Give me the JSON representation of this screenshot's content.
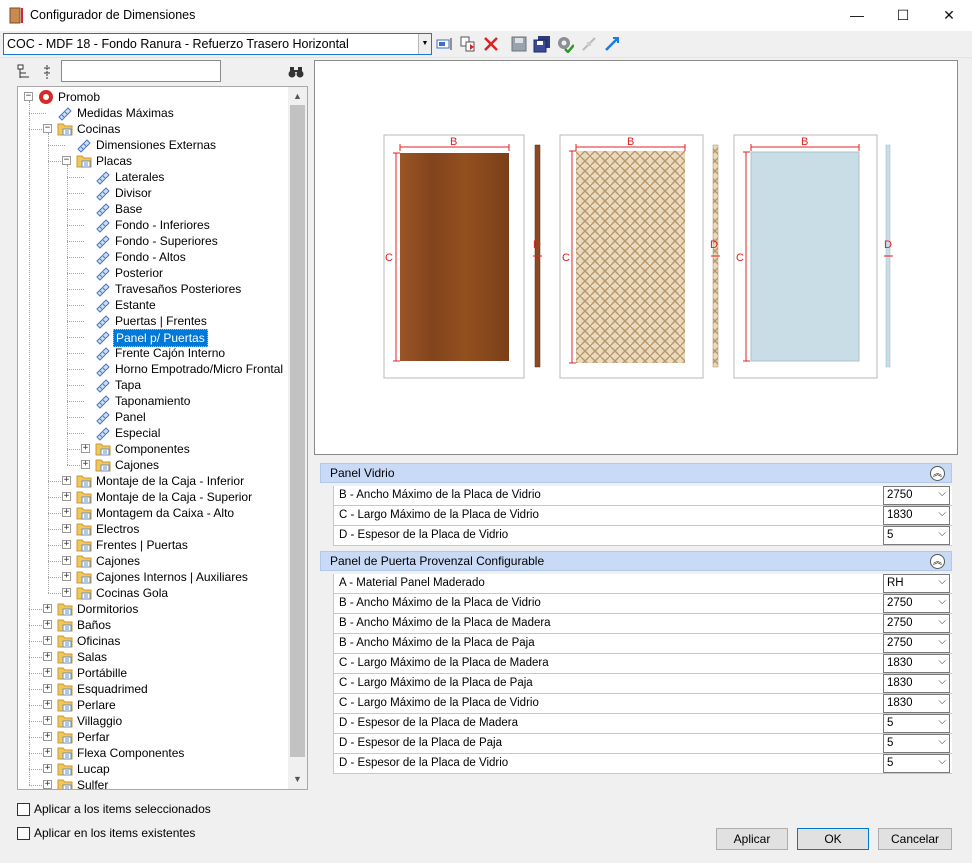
{
  "window": {
    "title": "Configurador de Dimensiones",
    "controls": {
      "minimize": "—",
      "maximize": "☐",
      "close": "✕"
    }
  },
  "toolbar": {
    "profile_value": "COC - MDF 18 - Fondo Ranura - Refuerzo Trasero Horizontal",
    "icons": [
      "rename-icon",
      "copy-icon",
      "delete-icon",
      "save-icon",
      "save-all-icon",
      "settings-gear-icon",
      "collapse-icon",
      "expand-icon"
    ]
  },
  "tree": {
    "search_placeholder": "",
    "items": [
      {
        "label": "Promob",
        "level": 0,
        "expander": "−",
        "icon": "promob"
      },
      {
        "label": "Medidas Máximas",
        "level": 1,
        "expander": "",
        "icon": "rule"
      },
      {
        "label": "Cocinas",
        "level": 1,
        "expander": "−",
        "icon": "folder"
      },
      {
        "label": "Dimensiones Externas",
        "level": 2,
        "expander": "",
        "icon": "rule"
      },
      {
        "label": "Placas",
        "level": 2,
        "expander": "−",
        "icon": "folder"
      },
      {
        "label": "Laterales",
        "level": 3,
        "expander": "",
        "icon": "rule"
      },
      {
        "label": "Divisor",
        "level": 3,
        "expander": "",
        "icon": "rule"
      },
      {
        "label": "Base",
        "level": 3,
        "expander": "",
        "icon": "rule"
      },
      {
        "label": "Fondo - Inferiores",
        "level": 3,
        "expander": "",
        "icon": "rule"
      },
      {
        "label": "Fondo - Superiores",
        "level": 3,
        "expander": "",
        "icon": "rule"
      },
      {
        "label": "Fondo - Altos",
        "level": 3,
        "expander": "",
        "icon": "rule"
      },
      {
        "label": "Posterior",
        "level": 3,
        "expander": "",
        "icon": "rule"
      },
      {
        "label": "Travesaños Posteriores",
        "level": 3,
        "expander": "",
        "icon": "rule"
      },
      {
        "label": "Estante",
        "level": 3,
        "expander": "",
        "icon": "rule"
      },
      {
        "label": "Puertas | Frentes",
        "level": 3,
        "expander": "",
        "icon": "rule"
      },
      {
        "label": "Panel p/ Puertas",
        "level": 3,
        "expander": "",
        "icon": "rule",
        "selected": true
      },
      {
        "label": "Frente Cajón Interno",
        "level": 3,
        "expander": "",
        "icon": "rule"
      },
      {
        "label": "Horno Empotrado/Micro Frontal",
        "level": 3,
        "expander": "",
        "icon": "rule"
      },
      {
        "label": "Tapa",
        "level": 3,
        "expander": "",
        "icon": "rule"
      },
      {
        "label": "Taponamiento",
        "level": 3,
        "expander": "",
        "icon": "rule"
      },
      {
        "label": "Panel",
        "level": 3,
        "expander": "",
        "icon": "rule"
      },
      {
        "label": "Especial",
        "level": 3,
        "expander": "",
        "icon": "rule"
      },
      {
        "label": "Componentes",
        "level": 3,
        "expander": "+",
        "icon": "folder"
      },
      {
        "label": "Cajones",
        "level": 3,
        "expander": "+",
        "icon": "folder"
      },
      {
        "label": "Montaje de la Caja - Inferior",
        "level": 2,
        "expander": "+",
        "icon": "folder"
      },
      {
        "label": "Montaje de la Caja - Superior",
        "level": 2,
        "expander": "+",
        "icon": "folder"
      },
      {
        "label": "Montagem da Caixa - Alto",
        "level": 2,
        "expander": "+",
        "icon": "folder"
      },
      {
        "label": "Electros",
        "level": 2,
        "expander": "+",
        "icon": "folder"
      },
      {
        "label": "Frentes | Puertas",
        "level": 2,
        "expander": "+",
        "icon": "folder"
      },
      {
        "label": "Cajones",
        "level": 2,
        "expander": "+",
        "icon": "folder"
      },
      {
        "label": "Cajones Internos | Auxiliares",
        "level": 2,
        "expander": "+",
        "icon": "folder"
      },
      {
        "label": "Cocinas Gola",
        "level": 2,
        "expander": "+",
        "icon": "folder"
      },
      {
        "label": "Dormitorios",
        "level": 1,
        "expander": "+",
        "icon": "folder"
      },
      {
        "label": "Baños",
        "level": 1,
        "expander": "+",
        "icon": "folder"
      },
      {
        "label": "Oficinas",
        "level": 1,
        "expander": "+",
        "icon": "folder"
      },
      {
        "label": "Salas",
        "level": 1,
        "expander": "+",
        "icon": "folder"
      },
      {
        "label": "Portábille",
        "level": 1,
        "expander": "+",
        "icon": "folder"
      },
      {
        "label": "Esquadrimed",
        "level": 1,
        "expander": "+",
        "icon": "folder"
      },
      {
        "label": "Perlare",
        "level": 1,
        "expander": "+",
        "icon": "folder"
      },
      {
        "label": "Villaggio",
        "level": 1,
        "expander": "+",
        "icon": "folder"
      },
      {
        "label": "Perfar",
        "level": 1,
        "expander": "+",
        "icon": "folder"
      },
      {
        "label": "Flexa Componentes",
        "level": 1,
        "expander": "+",
        "icon": "folder"
      },
      {
        "label": "Lucap",
        "level": 1,
        "expander": "+",
        "icon": "folder"
      },
      {
        "label": "Sulfer",
        "level": 1,
        "expander": "+",
        "icon": "folder"
      }
    ]
  },
  "options": {
    "apply_selected": "Aplicar a los items seleccionados",
    "apply_existing": "Aplicar en los items existentes"
  },
  "preview": {
    "dim_b": "B",
    "dim_c": "C",
    "dim_d": "D",
    "colors": {
      "wood": "#8b4a22",
      "straw": "#d9c09a",
      "glass": "#c9dde6",
      "dimension": "#e02020"
    }
  },
  "groups": [
    {
      "title": "Panel Vidrio",
      "rows": [
        {
          "label": "B -  Ancho Máximo de la Placa de Vidrio",
          "value": "2750"
        },
        {
          "label": "C - Largo Máximo de la Placa de Vidrio",
          "value": "1830"
        },
        {
          "label": "D - Espesor de la Placa de Vidrio",
          "value": "5"
        }
      ]
    },
    {
      "title": "Panel de Puerta Provenzal Configurable",
      "rows": [
        {
          "label": "A - Material Panel Maderado",
          "value": "RH"
        },
        {
          "label": "B -  Ancho Máximo de la Placa de Vidrio",
          "value": "2750"
        },
        {
          "label": "B - Ancho Máximo de la Placa de Madera",
          "value": "2750"
        },
        {
          "label": "B - Ancho Máximo de la Placa de Paja",
          "value": "2750"
        },
        {
          "label": "C - Largo Máximo de la Placa de Madera",
          "value": "1830"
        },
        {
          "label": "C - Largo Máximo de la Placa de Paja",
          "value": "1830"
        },
        {
          "label": "C - Largo Máximo de la Placa de Vidrio",
          "value": "1830"
        },
        {
          "label": "D - Espesor de la Placa de Madera",
          "value": "5"
        },
        {
          "label": "D - Espesor de la Placa de Paja",
          "value": "5"
        },
        {
          "label": "D - Espesor de la Placa de Vidrio",
          "value": "5"
        }
      ]
    }
  ],
  "buttons": {
    "apply": "Aplicar",
    "ok": "OK",
    "cancel": "Cancelar"
  }
}
